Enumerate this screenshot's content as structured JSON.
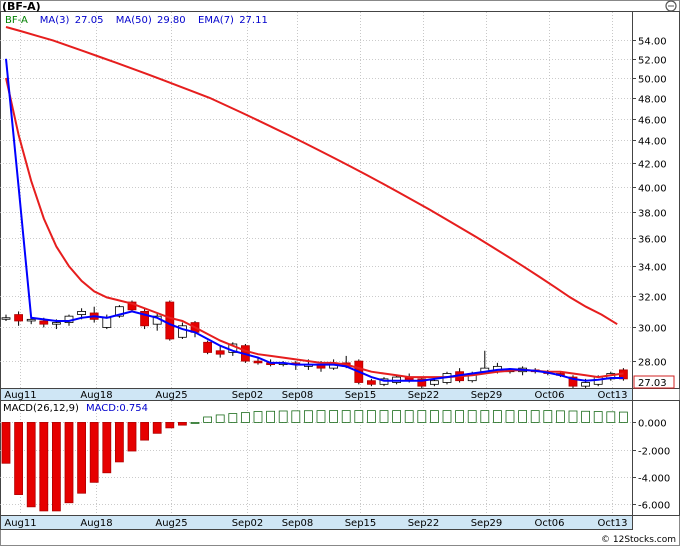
{
  "header": {
    "ticker": "(BF-A)",
    "legend": [
      {
        "label": "BF-A",
        "color": "#008000"
      },
      {
        "label": "MA(3)",
        "value": "27.05",
        "color": "#0000cc"
      },
      {
        "label": "MA(50)",
        "value": "29.80",
        "color": "#0000cc"
      },
      {
        "label": "EMA(7)",
        "value": "27.11",
        "color": "#0000cc"
      }
    ],
    "last_price_tag": "27.03",
    "macd_legend": {
      "label": "MACD(26,12,9)",
      "value_label": "MACD:0.754"
    },
    "watermark": "© 12Stocks.com"
  },
  "chart_data": [
    {
      "type": "candlestick",
      "price_axis_ticks": [
        "54.00",
        "52.00",
        "50.00",
        "48.00",
        "46.00",
        "44.00",
        "42.00",
        "40.00",
        "38.00",
        "36.00",
        "34.00",
        "32.00",
        "30.00",
        "28.00"
      ],
      "ylim": [
        26.5,
        57
      ],
      "y_scale": "log",
      "x_tick_labels": [
        "Aug11",
        "Aug18",
        "Aug25",
        "Sep02",
        "Sep08",
        "Sep15",
        "Sep22",
        "Sep29",
        "Oct06",
        "Oct13"
      ],
      "candles": [
        {
          "o": 30.6,
          "h": 30.8,
          "l": 30.4,
          "c": 30.6
        },
        {
          "o": 30.8,
          "h": 31.0,
          "l": 30.1,
          "c": 30.4
        },
        {
          "o": 30.4,
          "h": 30.7,
          "l": 30.2,
          "c": 30.5
        },
        {
          "o": 30.4,
          "h": 30.6,
          "l": 30.0,
          "c": 30.2
        },
        {
          "o": 30.2,
          "h": 30.5,
          "l": 29.9,
          "c": 30.3
        },
        {
          "o": 30.3,
          "h": 30.8,
          "l": 30.1,
          "c": 30.7
        },
        {
          "o": 30.8,
          "h": 31.2,
          "l": 30.5,
          "c": 31.0
        },
        {
          "o": 30.9,
          "h": 31.3,
          "l": 30.3,
          "c": 30.5
        },
        {
          "o": 30.0,
          "h": 30.8,
          "l": 29.9,
          "c": 30.6
        },
        {
          "o": 30.7,
          "h": 31.4,
          "l": 30.6,
          "c": 31.3
        },
        {
          "o": 31.6,
          "h": 31.7,
          "l": 31.0,
          "c": 31.1
        },
        {
          "o": 31.0,
          "h": 31.2,
          "l": 29.9,
          "c": 30.1
        },
        {
          "o": 30.2,
          "h": 30.9,
          "l": 29.8,
          "c": 30.7
        },
        {
          "o": 31.6,
          "h": 31.7,
          "l": 29.2,
          "c": 29.3
        },
        {
          "o": 29.4,
          "h": 30.3,
          "l": 29.3,
          "c": 30.1
        },
        {
          "o": 30.3,
          "h": 30.4,
          "l": 29.4,
          "c": 29.7
        },
        {
          "o": 29.1,
          "h": 29.2,
          "l": 28.4,
          "c": 28.5
        },
        {
          "o": 28.6,
          "h": 28.9,
          "l": 28.2,
          "c": 28.4
        },
        {
          "o": 28.5,
          "h": 29.1,
          "l": 28.3,
          "c": 29.0
        },
        {
          "o": 28.9,
          "h": 29.0,
          "l": 27.9,
          "c": 28.0
        },
        {
          "o": 28.0,
          "h": 28.2,
          "l": 27.8,
          "c": 27.9
        },
        {
          "o": 27.9,
          "h": 28.1,
          "l": 27.7,
          "c": 27.8
        },
        {
          "o": 27.8,
          "h": 28.0,
          "l": 27.7,
          "c": 27.9
        },
        {
          "o": 27.9,
          "h": 28.0,
          "l": 27.5,
          "c": 27.8
        },
        {
          "o": 27.7,
          "h": 28.1,
          "l": 27.5,
          "c": 27.8
        },
        {
          "o": 27.8,
          "h": 28.0,
          "l": 27.4,
          "c": 27.6
        },
        {
          "o": 27.6,
          "h": 28.1,
          "l": 27.5,
          "c": 27.9
        },
        {
          "o": 27.9,
          "h": 28.3,
          "l": 27.6,
          "c": 27.7
        },
        {
          "o": 28.0,
          "h": 28.1,
          "l": 26.7,
          "c": 26.8
        },
        {
          "o": 26.9,
          "h": 27.0,
          "l": 26.6,
          "c": 26.7
        },
        {
          "o": 26.7,
          "h": 27.1,
          "l": 26.6,
          "c": 27.0
        },
        {
          "o": 26.8,
          "h": 27.2,
          "l": 26.7,
          "c": 27.1
        },
        {
          "o": 27.1,
          "h": 27.3,
          "l": 26.8,
          "c": 26.9
        },
        {
          "o": 27.0,
          "h": 27.1,
          "l": 26.5,
          "c": 26.6
        },
        {
          "o": 26.7,
          "h": 27.0,
          "l": 26.6,
          "c": 26.9
        },
        {
          "o": 26.8,
          "h": 27.4,
          "l": 26.7,
          "c": 27.3
        },
        {
          "o": 27.4,
          "h": 27.6,
          "l": 26.8,
          "c": 26.9
        },
        {
          "o": 26.9,
          "h": 27.4,
          "l": 26.8,
          "c": 27.3
        },
        {
          "o": 27.4,
          "h": 28.6,
          "l": 27.3,
          "c": 27.6
        },
        {
          "o": 27.4,
          "h": 27.9,
          "l": 27.3,
          "c": 27.7
        },
        {
          "o": 27.4,
          "h": 27.6,
          "l": 27.3,
          "c": 27.5
        },
        {
          "o": 27.4,
          "h": 27.7,
          "l": 27.2,
          "c": 27.6
        },
        {
          "o": 27.5,
          "h": 27.6,
          "l": 27.3,
          "c": 27.4
        },
        {
          "o": 27.4,
          "h": 27.5,
          "l": 27.2,
          "c": 27.3
        },
        {
          "o": 27.3,
          "h": 27.4,
          "l": 27.1,
          "c": 27.2
        },
        {
          "o": 27.1,
          "h": 27.2,
          "l": 26.5,
          "c": 26.6
        },
        {
          "o": 26.6,
          "h": 27.0,
          "l": 26.5,
          "c": 26.8
        },
        {
          "o": 26.7,
          "h": 27.2,
          "l": 26.6,
          "c": 27.1
        },
        {
          "o": 27.0,
          "h": 27.4,
          "l": 26.9,
          "c": 27.3
        },
        {
          "o": 27.5,
          "h": 27.6,
          "l": 26.9,
          "c": 27.0
        }
      ],
      "series": [
        {
          "name": "MA(50)",
          "color": "#e61e1e",
          "values": [
            55.5,
            55.0,
            54.5,
            54.0,
            53.4,
            52.8,
            52.2,
            51.6,
            51.0,
            50.4,
            49.8,
            49.2,
            48.6,
            48.0,
            47.3,
            46.6,
            45.9,
            45.2,
            44.5,
            43.8,
            43.1,
            42.4,
            41.7,
            41.0,
            40.3,
            39.6,
            38.9,
            38.2,
            37.5,
            36.8,
            36.1,
            35.4,
            34.7,
            34.0,
            33.3,
            32.6,
            31.9,
            31.3,
            30.8,
            30.2
          ]
        },
        {
          "name": "EMA(7)",
          "color": "#e61e1e",
          "values": [
            50.0,
            44.5,
            40.5,
            37.5,
            35.4,
            34.0,
            33.0,
            32.3,
            31.9,
            31.7,
            31.5,
            31.2,
            30.9,
            30.6,
            30.4,
            30.0,
            29.6,
            29.2,
            28.9,
            28.6,
            28.4,
            28.3,
            28.2,
            28.1,
            28.0,
            27.9,
            27.9,
            27.8,
            27.6,
            27.4,
            27.3,
            27.2,
            27.1,
            27.1,
            27.1,
            27.1,
            27.15,
            27.2,
            27.3,
            27.4,
            27.45,
            27.5,
            27.45,
            27.4,
            27.4,
            27.3,
            27.2,
            27.1,
            27.2,
            27.3
          ]
        },
        {
          "name": "MA(3)",
          "color": "#0000ff",
          "values": [
            52.0,
            40.0,
            30.6,
            30.5,
            30.4,
            30.4,
            30.6,
            30.7,
            30.6,
            30.8,
            31.0,
            30.8,
            30.6,
            30.2,
            29.9,
            29.7,
            29.3,
            28.9,
            28.6,
            28.4,
            28.2,
            27.9,
            27.9,
            27.8,
            27.8,
            27.8,
            27.8,
            27.7,
            27.4,
            27.1,
            26.9,
            26.9,
            26.9,
            26.9,
            27.0,
            27.1,
            27.2,
            27.3,
            27.4,
            27.5,
            27.55,
            27.5,
            27.45,
            27.35,
            27.2,
            27.0,
            26.9,
            26.95,
            27.05,
            27.05
          ]
        }
      ]
    },
    {
      "type": "bar",
      "title": "MACD(26,12,9)",
      "ylim": [
        -6.8,
        1.5
      ],
      "y_ticks": [
        "0.000",
        "-2.000",
        "-4.000",
        "-6.000"
      ],
      "x_tick_labels": [
        "Aug11",
        "Aug18",
        "Aug25",
        "Sep02",
        "Sep08",
        "Sep15",
        "Sep22",
        "Sep29",
        "Oct06",
        "Oct13"
      ],
      "values": [
        -3.0,
        -5.3,
        -6.2,
        -6.5,
        -6.5,
        -5.9,
        -5.2,
        -4.4,
        -3.7,
        -2.9,
        -2.1,
        -1.3,
        -0.8,
        -0.4,
        -0.2,
        0.0,
        0.4,
        0.55,
        0.65,
        0.72,
        0.8,
        0.82,
        0.84,
        0.85,
        0.86,
        0.87,
        0.87,
        0.87,
        0.87,
        0.87,
        0.87,
        0.87,
        0.87,
        0.87,
        0.87,
        0.87,
        0.87,
        0.87,
        0.87,
        0.87,
        0.87,
        0.87,
        0.87,
        0.87,
        0.85,
        0.84,
        0.82,
        0.8,
        0.78,
        0.76
      ]
    }
  ]
}
